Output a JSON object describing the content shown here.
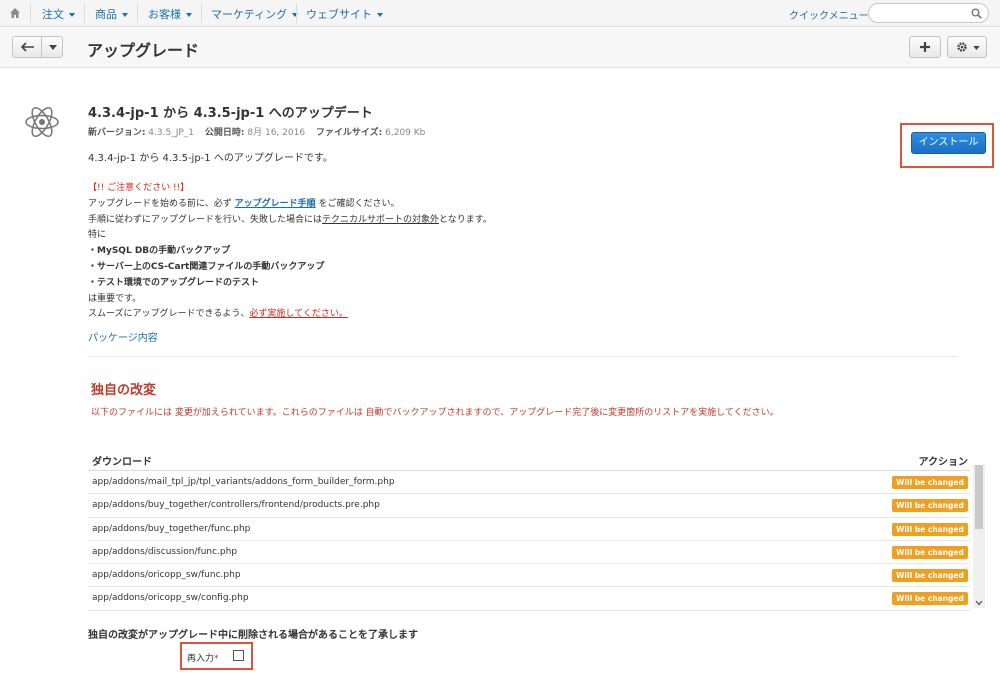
{
  "nav": {
    "items": [
      {
        "label": "注文"
      },
      {
        "label": "商品"
      },
      {
        "label": "お客様"
      },
      {
        "label": "マーケティング"
      },
      {
        "label": "ウェブサイト"
      }
    ],
    "quick_menu": "クイックメニュー"
  },
  "header": {
    "title": "アップグレード"
  },
  "upgrade": {
    "title": "4.3.4-jp-1 から 4.3.5-jp-1 へのアップデート",
    "new_version_label": "新バージョン:",
    "new_version": "4.3.5_JP_1",
    "published_label": "公開日時:",
    "published": "8月 16, 2016",
    "filesize_label": "ファイルサイズ:",
    "filesize": "6,209 Kb",
    "description": "4.3.4-jp-1 から 4.3.5-jp-1 へのアップグレードです。",
    "install_label": "インストール",
    "notice": {
      "warning": "【!! ご注意ください !!】",
      "line1_pre": "アップグレードを始める前に、必ず ",
      "line1_link": "アップグレード手順",
      "line1_post": " をご確認ください。",
      "line2_pre": "手順に従わずにアップグレードを行い、失敗した場合には",
      "line2_ul": "テクニカルサポートの対象外",
      "line2_post": "となります。",
      "line3": "特に",
      "bullet1": "・MySQL DBの手動バックアップ",
      "bullet2": "・サーバー上のCS-Cart関連ファイルの手動バックアップ",
      "bullet3": "・テスト環境でのアップグレードのテスト",
      "line4": "は重要です。",
      "line5_pre": "スムーズにアップグレードできるよう、",
      "line5_red": "必ず実施してください。"
    },
    "package_link": "パッケージ内容"
  },
  "custom_changes": {
    "title": "独自の改変",
    "description": "以下のファイルには 変更が加えられています。これらのファイルは 自動でバックアップされますので、アップグレード完了後に変更箇所のリストアを実施してください。",
    "col_download": "ダウンロード",
    "col_action": "アクション",
    "rows": [
      {
        "path": "app/addons/mail_tpl_jp/tpl_variants/addons_form_builder_form.php",
        "status": "Will be changed"
      },
      {
        "path": "app/addons/buy_together/controllers/frontend/products.pre.php",
        "status": "Will be changed"
      },
      {
        "path": "app/addons/buy_together/func.php",
        "status": "Will be changed"
      },
      {
        "path": "app/addons/discussion/func.php",
        "status": "Will be changed"
      },
      {
        "path": "app/addons/oricopp_sw/func.php",
        "status": "Will be changed"
      },
      {
        "path": "app/addons/oricopp_sw/config.php",
        "status": "Will be changed"
      }
    ],
    "ack": "独自の改変がアップグレード中に削除される場合があることを了承します",
    "reenter_label": "再入力",
    "required_mark": "*"
  },
  "colors": {
    "accent": "#1a6fb0",
    "warning": "#d9261c",
    "badge": "#f0a020",
    "highlight_box": "#e0533b"
  }
}
